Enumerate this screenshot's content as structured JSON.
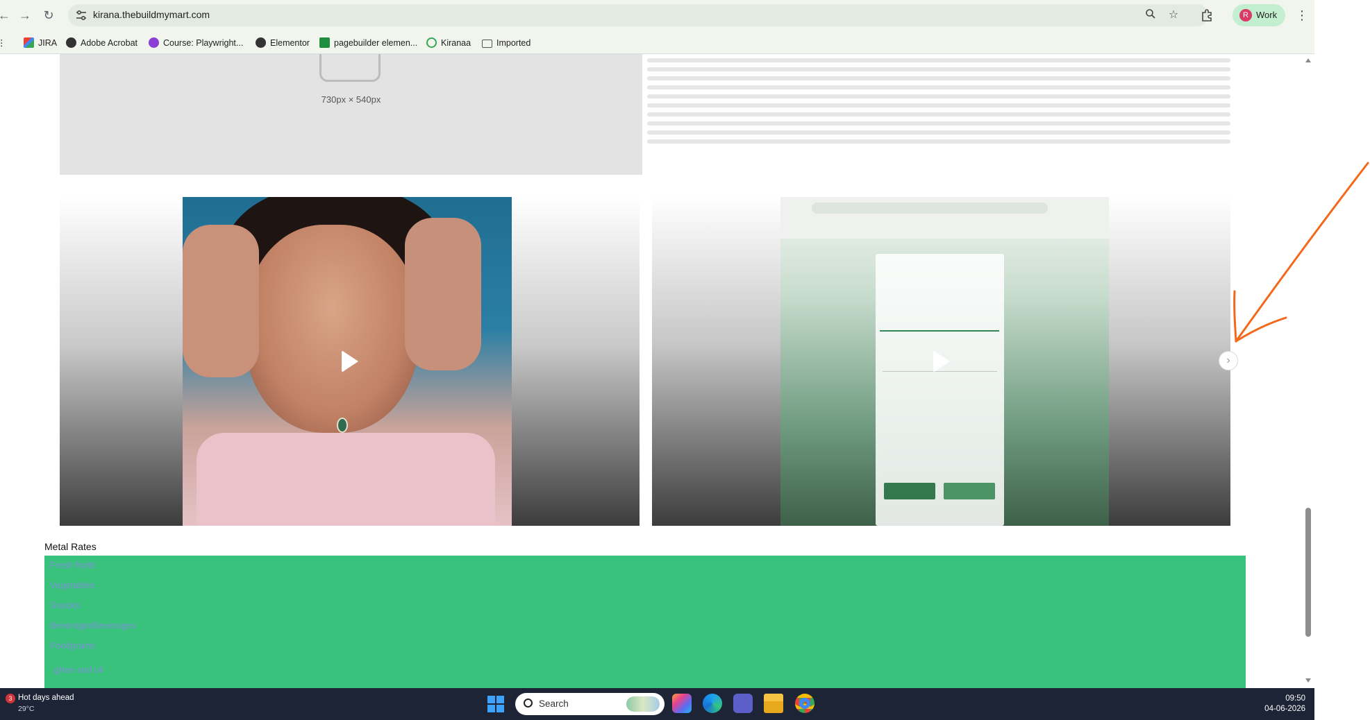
{
  "browser": {
    "url": "kirana.thebuildmymart.com",
    "profile_initial": "R",
    "profile_label": "Work",
    "bookmarks": [
      {
        "label": "JIRA",
        "icon": "gmail-icon"
      },
      {
        "label": "Adobe Acrobat",
        "icon": "globe-icon"
      },
      {
        "label": "Course: Playwright...",
        "icon": "course-icon"
      },
      {
        "label": "Elementor",
        "icon": "globe-icon"
      },
      {
        "label": "pagebuilder elemen...",
        "icon": "sheets-icon"
      },
      {
        "label": "Kiranaa",
        "icon": "check-icon"
      },
      {
        "label": "Imported",
        "icon": "folder-icon"
      }
    ]
  },
  "page": {
    "placeholder_text": "730px × 540px",
    "metal_rates_title": "Metal Rates",
    "metal_rates_items": [
      "Fresh fruits",
      "Vegetables",
      "Snacks",
      "BeveragesBeverages",
      "Foodgrains",
      "ghee and oil"
    ]
  },
  "taskbar": {
    "weather_count": "3",
    "weather_title": "Hot days ahead",
    "weather_temp": "29°C",
    "search_label": "Search",
    "time": "09:50",
    "date": "04-06-2026"
  },
  "colors": {
    "metal_panel": "#38c27c",
    "arrow": "#f2691c",
    "taskbar": "#1c2436"
  }
}
